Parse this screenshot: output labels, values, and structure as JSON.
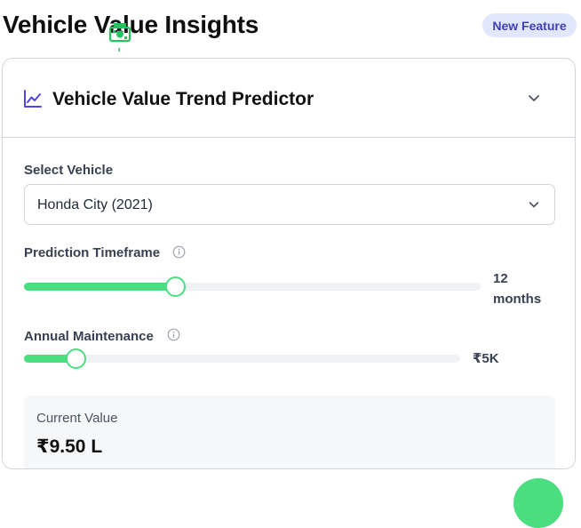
{
  "header": {
    "title": "Vehicle Value Insights",
    "badge": "New Feature",
    "decorative_icon": "money-icon"
  },
  "card": {
    "title": "Vehicle Value Trend Predictor",
    "title_icon": "trend-chart-icon",
    "collapse_icon": "chevron-down-icon"
  },
  "vehicle_select": {
    "label": "Select Vehicle",
    "value": "Honda City (2021)"
  },
  "timeframe": {
    "label": "Prediction Timeframe",
    "value_line1": "12",
    "value_line2": "months",
    "fill_fraction": 0.33
  },
  "maintenance": {
    "label": "Annual Maintenance",
    "value": "₹5K",
    "fill_fraction": 0.118
  },
  "current_value": {
    "caption": "Current Value",
    "amount": "₹9.50 L"
  },
  "colors": {
    "accent_green": "#4ade80",
    "badge_bg": "#e0e7ff",
    "badge_text": "#3f3fb4",
    "trend_icon": "#4f46e5"
  }
}
